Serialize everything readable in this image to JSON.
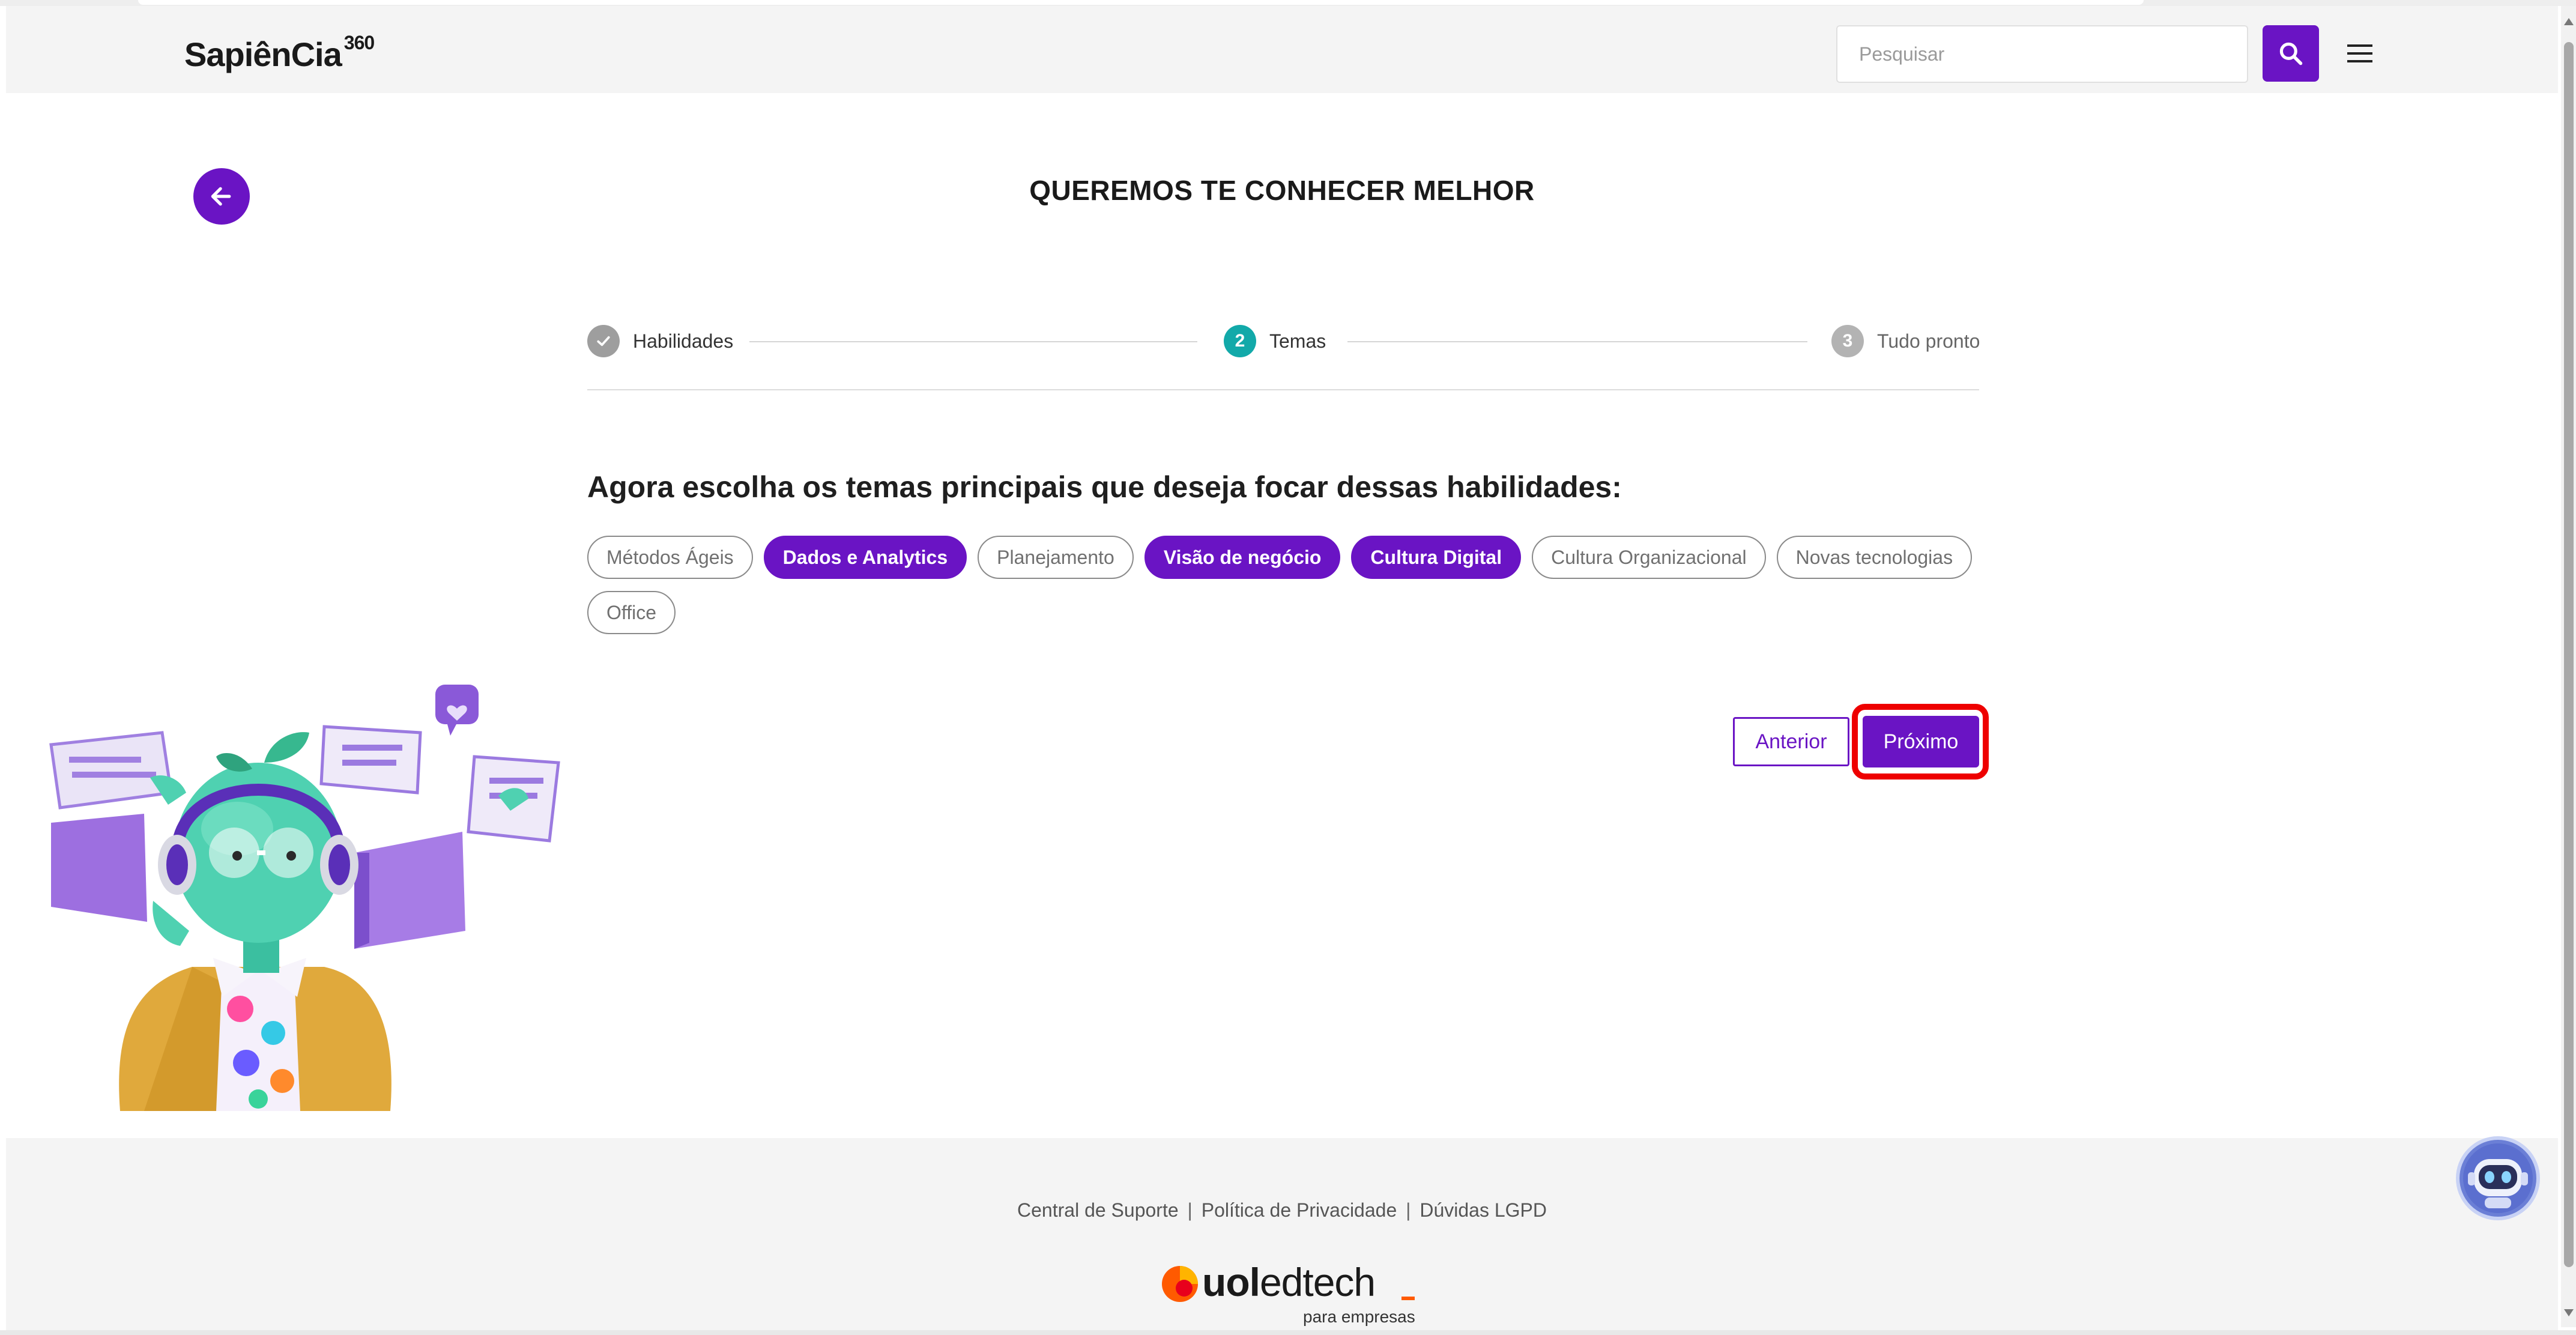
{
  "header": {
    "logo_text": "SapiênCia",
    "logo_sup": "360",
    "search_placeholder": "Pesquisar"
  },
  "page": {
    "title": "QUEREMOS TE CONHECER MELHOR"
  },
  "stepper": {
    "steps": [
      {
        "number": "",
        "label": "Habilidades",
        "state": "completed"
      },
      {
        "number": "2",
        "label": "Temas",
        "state": "active"
      },
      {
        "number": "3",
        "label": "Tudo pronto",
        "state": "pending"
      }
    ]
  },
  "question": "Agora escolha os temas principais que deseja focar dessas habilidades:",
  "topics": [
    {
      "label": "Métodos Ágeis",
      "selected": false
    },
    {
      "label": "Dados e Analytics",
      "selected": true
    },
    {
      "label": "Planejamento",
      "selected": false
    },
    {
      "label": "Visão de negócio",
      "selected": true
    },
    {
      "label": "Cultura Digital",
      "selected": true
    },
    {
      "label": "Cultura Organizacional",
      "selected": false
    },
    {
      "label": "Novas tecnologias",
      "selected": false
    },
    {
      "label": "Office",
      "selected": false
    }
  ],
  "actions": {
    "previous_label": "Anterior",
    "next_label": "Próximo"
  },
  "footer": {
    "links": [
      "Central de Suporte",
      "Política de Privacidade",
      "Dúvidas LGPD"
    ],
    "separator": "|",
    "brand_uol": "uol",
    "brand_edtech": "edtech",
    "brand_sub": "para empresas"
  },
  "colors": {
    "primary": "#6a14c4",
    "step_completed": "#9e9e9e",
    "step_active": "#12a9a9",
    "step_pending": "#b3b3b3",
    "highlight": "#ee0000",
    "brand_orange": "#ff5a00"
  }
}
